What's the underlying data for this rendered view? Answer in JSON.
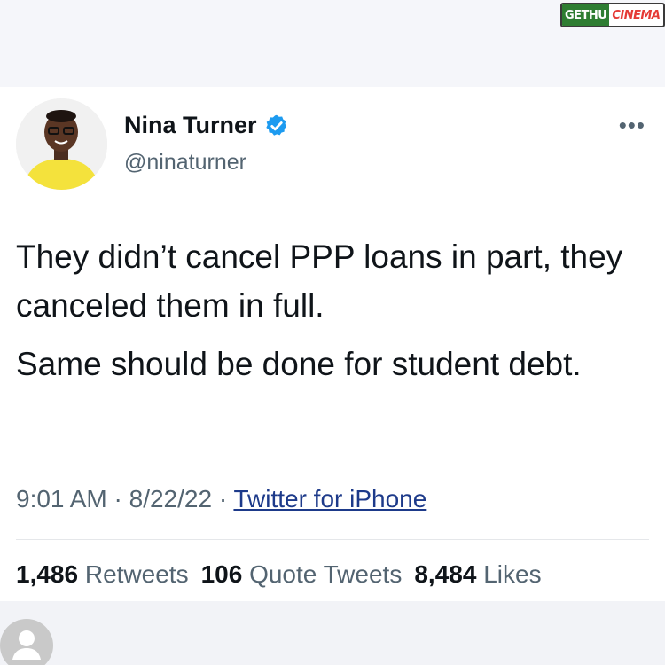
{
  "watermark": {
    "part1": "GETHU",
    "part2": "CINEMA"
  },
  "tweet": {
    "author": {
      "name": "Nina Turner",
      "handle": "@ninaturner",
      "verified": true,
      "avatar_icon": "profile-photo"
    },
    "more_label": "•••",
    "text": [
      "They didn’t cancel PPP loans in part, they canceled them in full.",
      "Same should be done for student debt."
    ],
    "time": "9:01 AM",
    "separator": " · ",
    "date": "8/22/22",
    "source": "Twitter for iPhone",
    "stats": {
      "retweets_count": "1,486",
      "retweets_label": "Retweets",
      "quotes_count": "106",
      "quotes_label": "Quote Tweets",
      "likes_count": "8,484",
      "likes_label": "Likes"
    }
  },
  "colors": {
    "text": "#0f1419",
    "muted": "#536471",
    "verified": "#1d9bf0",
    "avatar_bg": "#f4e23c"
  }
}
